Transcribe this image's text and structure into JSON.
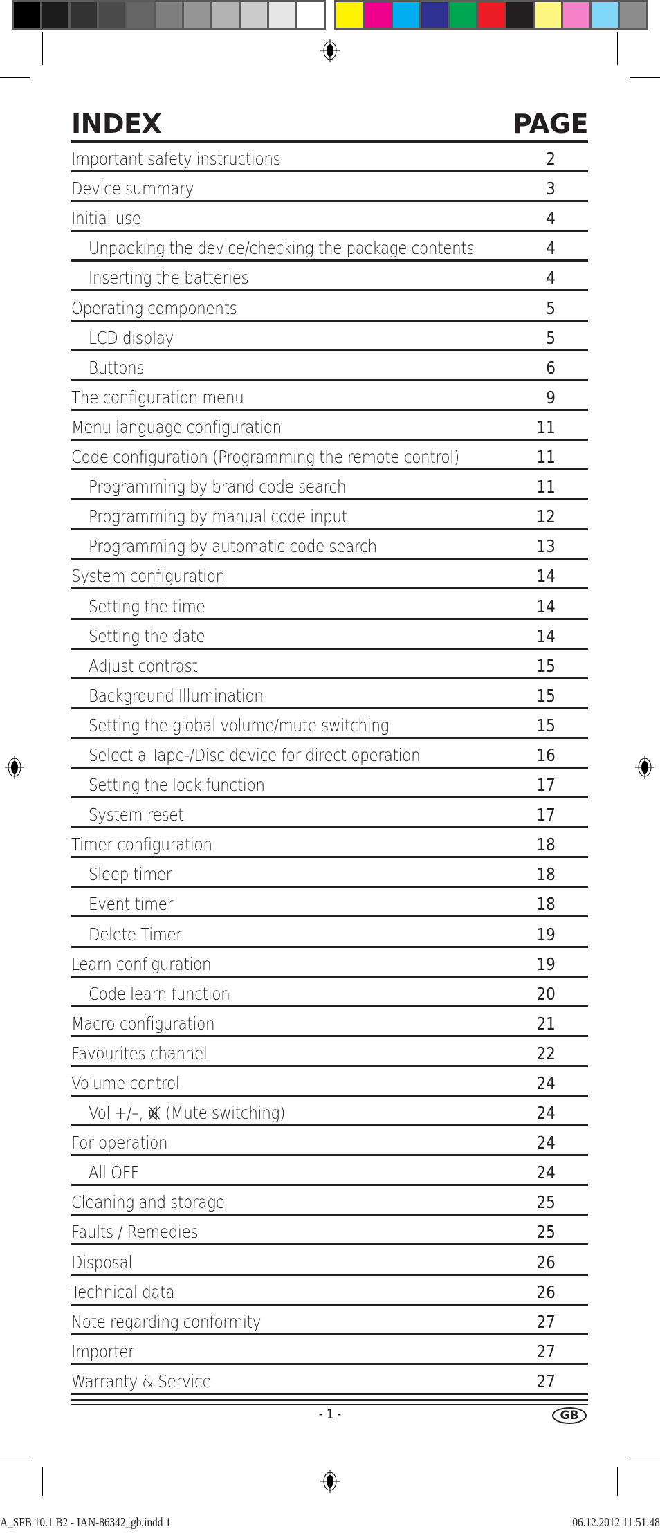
{
  "color_bar": {
    "gray_swatches": [
      "#000000",
      "#1c1c1c",
      "#333333",
      "#4a4a4a",
      "#666666",
      "#7f7f7f",
      "#959595",
      "#b2b2b2",
      "#cccccc",
      "#e5e5e5",
      "#ffffff"
    ],
    "color_swatches": [
      "#fff200",
      "#ec008c",
      "#00aeef",
      "#2e3192",
      "#00a651",
      "#ed1c24",
      "#231f20",
      "#fff67f",
      "#f582c9",
      "#7fd6f7",
      "#8c8c8c"
    ]
  },
  "header": {
    "index_label": "INDEX",
    "page_label": "PAGE"
  },
  "toc": [
    {
      "title": "Important safety instructions",
      "page": "2",
      "level": 0
    },
    {
      "title": "Device summary",
      "page": "3",
      "level": 0
    },
    {
      "title": "Initial use",
      "page": "4",
      "level": 0
    },
    {
      "title": "Unpacking the device/checking the package contents",
      "page": "4",
      "level": 1
    },
    {
      "title": "Inserting the batteries",
      "page": "4",
      "level": 1
    },
    {
      "title": "Operating components",
      "page": "5",
      "level": 0
    },
    {
      "title": "LCD display",
      "page": "5",
      "level": 1
    },
    {
      "title": "Buttons",
      "page": "6",
      "level": 1
    },
    {
      "title": "The configuration menu",
      "page": "9",
      "level": 0
    },
    {
      "title": "Menu language configuration",
      "page": "11",
      "level": 0
    },
    {
      "title": "Code configuration (Programming the remote control)",
      "page": "11",
      "level": 0
    },
    {
      "title": "Programming by brand code search",
      "page": "11",
      "level": 1
    },
    {
      "title": "Programming by manual code input",
      "page": "12",
      "level": 1
    },
    {
      "title": "Programming by automatic code search",
      "page": "13",
      "level": 1
    },
    {
      "title": "System configuration",
      "page": "14",
      "level": 0
    },
    {
      "title": "Setting the time",
      "page": "14",
      "level": 1
    },
    {
      "title": "Setting the date",
      "page": "14",
      "level": 1
    },
    {
      "title": "Adjust contrast",
      "page": "15",
      "level": 1
    },
    {
      "title": "Background Illumination",
      "page": "15",
      "level": 1
    },
    {
      "title": "Setting the global volume/mute switching",
      "page": "15",
      "level": 1
    },
    {
      "title": "Select a Tape-/Disc device for direct operation",
      "page": "16",
      "level": 1
    },
    {
      "title": "Setting the lock function",
      "page": "17",
      "level": 1
    },
    {
      "title": "System reset",
      "page": "17",
      "level": 1
    },
    {
      "title": "Timer configuration",
      "page": "18",
      "level": 0
    },
    {
      "title": "Sleep timer",
      "page": "18",
      "level": 1
    },
    {
      "title": "Event timer",
      "page": "18",
      "level": 1
    },
    {
      "title": "Delete Timer",
      "page": "19",
      "level": 1
    },
    {
      "title": "Learn configuration",
      "page": "19",
      "level": 0
    },
    {
      "title": "Code learn function",
      "page": "20",
      "level": 1
    },
    {
      "title": "Macro configuration",
      "page": "21",
      "level": 0
    },
    {
      "title": "Favourites channel",
      "page": "22",
      "level": 0
    },
    {
      "title": "Volume control",
      "page": "24",
      "level": 0
    },
    {
      "title": "Vol +/–,",
      "title_suffix": "(Mute switching)",
      "icon": "mute-icon",
      "page": "24",
      "level": 1
    },
    {
      "title": "For operation",
      "page": "24",
      "level": 0
    },
    {
      "title": "All OFF",
      "page": "24",
      "level": 1
    },
    {
      "title": "Cleaning and storage",
      "page": "25",
      "level": 0
    },
    {
      "title": "Faults / Remedies",
      "page": "25",
      "level": 0
    },
    {
      "title": "Disposal",
      "page": "26",
      "level": 0
    },
    {
      "title": "Technical data",
      "page": "26",
      "level": 0
    },
    {
      "title": "Note regarding conformity",
      "page": "27",
      "level": 0
    },
    {
      "title": "Importer",
      "page": "27",
      "level": 0
    },
    {
      "title": "Warranty & Service",
      "page": "27",
      "level": 0
    }
  ],
  "footer": {
    "page_number": "- 1 -",
    "language_badge": "GB",
    "slug_file": "A_SFB 10.1 B2 - IAN-86342_gb.indd   1",
    "slug_timestamp": "06.12.2012   11:51:48"
  }
}
